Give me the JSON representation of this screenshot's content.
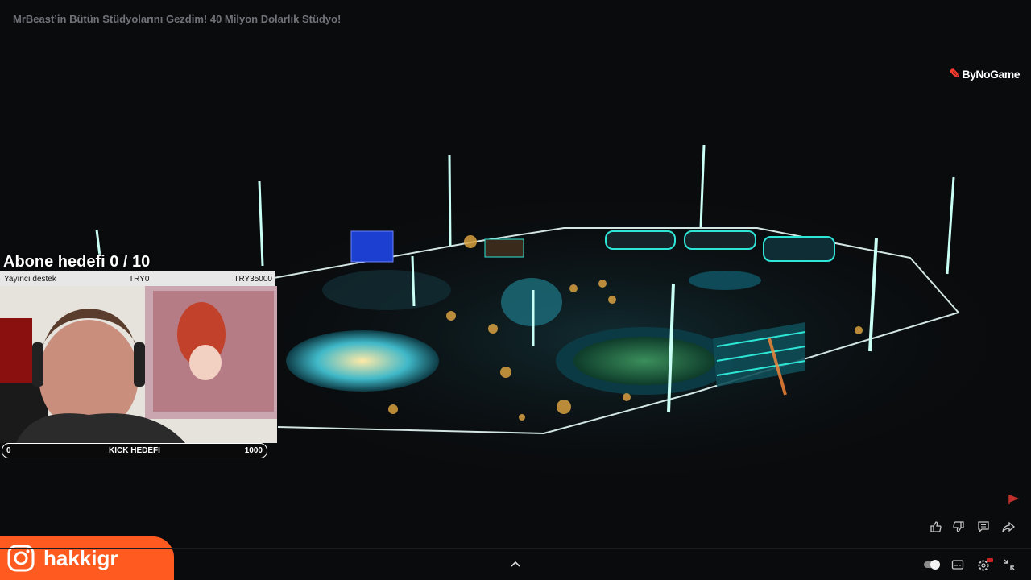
{
  "video": {
    "title": "MrBeast’in Bütün Stüdyolarını Gezdim! 40 Milyon Dolarlık Stüdyo!",
    "watermark": "ByNoGame"
  },
  "overlay": {
    "sub_goal": "Abone hedefi 0 / 10",
    "donation": {
      "label": "Yayıncı destek",
      "current": "TRY0",
      "target": "TRY35000"
    },
    "kick_goal": {
      "start": "0",
      "label": "KICK HEDEFI",
      "end": "1000"
    },
    "instagram_handle": "hakkigr"
  },
  "controls": {
    "like_icon": "thumbs-up-icon",
    "dislike_icon": "thumbs-down-icon",
    "comment_icon": "comment-icon",
    "share_icon": "share-icon",
    "expand_icon": "chevron-up-icon",
    "autoplay_icon": "toggle-icon",
    "captions_icon": "captions-icon",
    "settings_icon": "gear-icon",
    "minimize_icon": "exit-fullscreen-icon"
  },
  "colors": {
    "background": "#0a0b0d",
    "accent_cyan": "#2ee6d6",
    "instagram_orange": "#ff5a1f",
    "brand_red": "#ff3b30"
  }
}
